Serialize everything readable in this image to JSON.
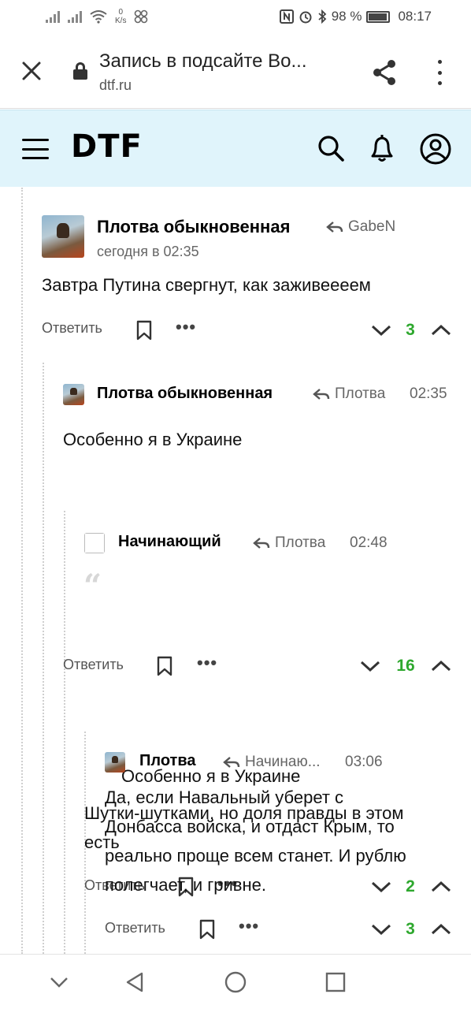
{
  "status_bar": {
    "net_speed_value": "0",
    "net_speed_unit": "K/s",
    "battery": "98 %",
    "time": "08:17"
  },
  "browser": {
    "title": "Запись в подсайте Во...",
    "url": "dtf.ru"
  },
  "site": {
    "logo": "DTF"
  },
  "comments": [
    {
      "author": "Плотва обыкновенная",
      "reply_to": "GabeN",
      "time": "сегодня в 02:35",
      "text": "Завтра Путина свергнут, как заживеееем",
      "reply_label": "Ответить",
      "votes": "3"
    },
    {
      "author": "Плотва обыкновенная",
      "reply_to": "Плотва",
      "time": "02:35",
      "text": "Особенно я в Украине",
      "reply_label": "Ответить",
      "votes": "16"
    },
    {
      "author": "Начинающий",
      "reply_to": "Плотва",
      "time": "02:48",
      "quote_mark": "“",
      "quote": "Особенно я в Украине",
      "text_lines": [
        "Шутки-шутками, но доля правды в этом",
        "есть"
      ],
      "reply_label": "Ответить",
      "votes": "2"
    },
    {
      "author": "Плотва",
      "reply_to": "Начинаю...",
      "time": "03:06",
      "text_lines": [
        "Да, если Навальный уберет с",
        "Донбасса войска, и отдаст Крым, то",
        "реально проще всем станет. И рублю",
        "полегчает, и гривне."
      ],
      "reply_label": "Ответить",
      "votes": "3"
    }
  ],
  "more_label": "•••",
  "icons": {
    "close": "close-icon",
    "lock": "lock-icon",
    "share": "share-icon",
    "menu": "more-vert-icon",
    "burger": "hamburger-menu-icon",
    "search": "search-icon",
    "bell": "bell-icon",
    "user": "user-icon",
    "reply": "reply-arrow-icon",
    "bookmark": "bookmark-icon",
    "vote_down": "chevron-down-icon",
    "vote_up": "chevron-up-icon"
  },
  "colors": {
    "header_bg": "#e0f4fb",
    "vote_positive": "#2ea82e"
  }
}
